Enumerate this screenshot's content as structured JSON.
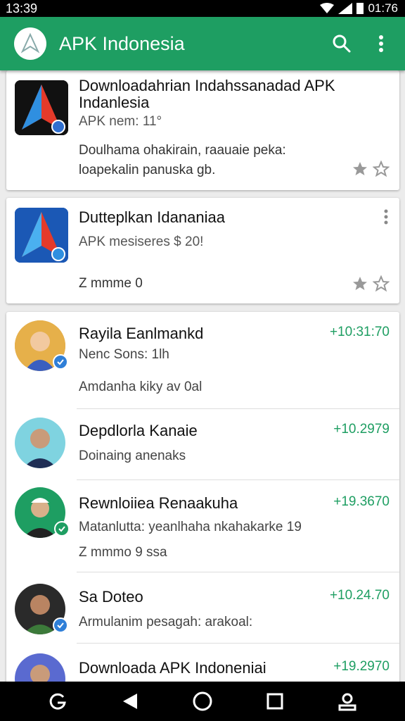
{
  "status_bar": {
    "time": "13:39",
    "right_time": "01:76"
  },
  "app_bar": {
    "title": "APK Indonesia"
  },
  "cards": [
    {
      "title": "Downloadahrian Indahssanadad APK Indanlesia",
      "sub": "APK nem: 11°",
      "desc_line1": "Doulhama ohakirain, raauaie peka:",
      "desc_line2": "loapekalin panuska gb."
    },
    {
      "title": "Dutteplkan Idananiaa",
      "sub": "APK mesiseres $ 20!",
      "desc_line1": "Z mmme 0"
    }
  ],
  "chats": [
    {
      "name": "Rayila Eanlmankd",
      "time": "+10:31:70",
      "msg1": "Nenc Sons: 1lh",
      "msg2": "Amdanha kiky av 0al"
    },
    {
      "name": "Depdlorla Kanaie",
      "time": "+10.2979",
      "msg1": "Doinaing anenaks"
    },
    {
      "name": "Rewnloiiea Renaakuha",
      "time": "+19.3670",
      "msg1": "Matanlutta: yeanlhaha nkahakarke 19",
      "msg2": "Z mmmo 9 ssa"
    },
    {
      "name": "Sa Doteo",
      "time": "+10.24.70",
      "msg1": "Armulanim pesagah: arakoal:"
    },
    {
      "name": "Downloada APK Indoneniai",
      "time": "+19.2970"
    }
  ],
  "icons": {
    "search": "search-icon",
    "more": "more-vert-icon",
    "star": "star-icon",
    "nav_google": "google-icon",
    "nav_back": "back-icon",
    "nav_home": "home-icon",
    "nav_recents": "recents-icon",
    "nav_profile": "profile-icon"
  },
  "colors": {
    "accent": "#1e9e62",
    "time": "#1e9e62"
  }
}
